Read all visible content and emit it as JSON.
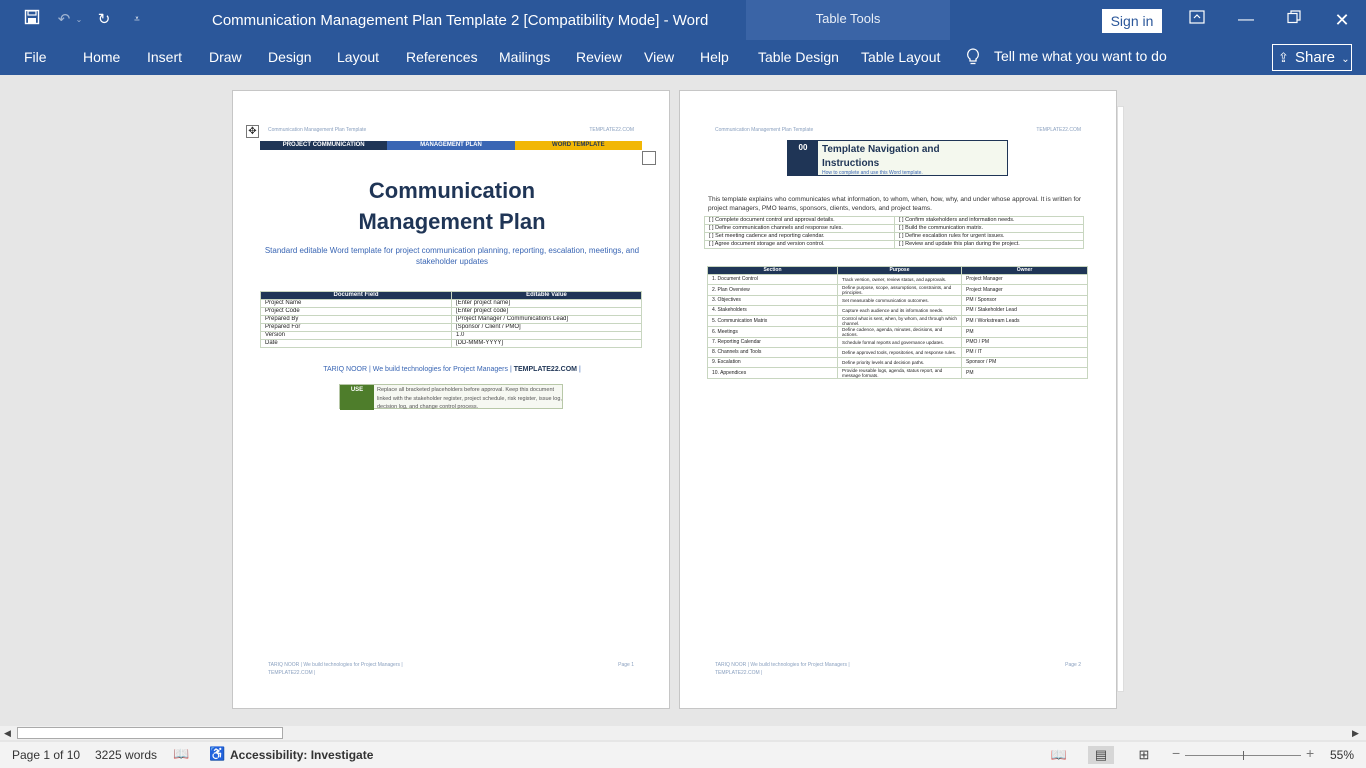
{
  "window": {
    "title": "Communication Management Plan Template 2 [Compatibility Mode]  -  Word",
    "context_label": "Table Tools",
    "sign_in": "Sign in"
  },
  "ribbon": {
    "tabs": [
      "File",
      "Home",
      "Insert",
      "Draw",
      "Design",
      "Layout",
      "References",
      "Mailings",
      "Review",
      "View",
      "Help",
      "Table Design",
      "Table Layout"
    ],
    "tell_me": "Tell me what you want to do",
    "share": "Share"
  },
  "page1": {
    "header_left": "Communication Management Plan Template",
    "header_right": "TEMPLATE22.COM",
    "band": [
      "PROJECT COMMUNICATION",
      "MANAGEMENT PLAN",
      "WORD TEMPLATE"
    ],
    "title_line1": "Communication",
    "title_line2": "Management Plan",
    "subtitle": "Standard editable Word template for project communication planning, reporting, escalation, meetings, and stakeholder updates",
    "table_headers": [
      "Document Field",
      "Editable Value"
    ],
    "table_rows": [
      [
        "Project Name",
        "[Enter project name]"
      ],
      [
        "Project Code",
        "[Enter project code]"
      ],
      [
        "Prepared By",
        "[Project Manager / Communications Lead]"
      ],
      [
        "Prepared For",
        "[Sponsor / Client / PMO]"
      ],
      [
        "Version",
        "1.0"
      ],
      [
        "Date",
        "[DD-MMM-YYYY]"
      ]
    ],
    "brand_text": "TARIQ NOOR | We build technologies for Project Managers |",
    "brand_bold": "TEMPLATE22.COM",
    "brand_end": "|",
    "use_tag": "USE",
    "use_text": "Replace all bracketed placeholders before approval. Keep this document linked with the stakeholder register, project schedule, risk register, issue log, decision log, and change control process.",
    "footer_left": "TARIQ NOOR | We build technologies for Project Managers | TEMPLATE22.COM |",
    "footer_right": "Page 1"
  },
  "page2": {
    "header_left": "Communication Management Plan Template",
    "header_right": "TEMPLATE22.COM",
    "nav_number": "00",
    "nav_title": "Template Navigation and Instructions",
    "nav_sub": "How to complete and use this Word template.",
    "intro": "This template explains who communicates what information, to whom, when, how, why, and under whose approval. It is written for project managers, PMO teams, sponsors, clients, vendors, and project teams.",
    "checklist": [
      [
        "[ ] Complete document control and approval details.",
        "[ ] Confirm stakeholders and information needs."
      ],
      [
        "[ ] Define communication channels and response rules.",
        "[ ] Build the communication matrix."
      ],
      [
        "[ ] Set meeting cadence and reporting calendar.",
        "[ ] Define escalation rules for urgent issues."
      ],
      [
        "[ ] Agree document storage and version control.",
        "[ ] Review and update this plan during the project."
      ]
    ],
    "sections_headers": [
      "Section",
      "Purpose",
      "Owner"
    ],
    "sections": [
      [
        "1. Document Control",
        "Track version, owner, review status, and approvals.",
        "Project Manager"
      ],
      [
        "2. Plan Overview",
        "Define purpose, scope, assumptions, constraints, and principles.",
        "Project Manager"
      ],
      [
        "3. Objectives",
        "Set measurable communication outcomes.",
        "PM / Sponsor"
      ],
      [
        "4. Stakeholders",
        "Capture each audience and its information needs.",
        "PM / Stakeholder Lead"
      ],
      [
        "5. Communication Matrix",
        "Control what is sent, when, by whom, and through which channel.",
        "PM / Workstream Leads"
      ],
      [
        "6. Meetings",
        "Define cadence, agenda, minutes, decisions, and actions.",
        "PM"
      ],
      [
        "7. Reporting Calendar",
        "Schedule formal reports and governance updates.",
        "PMO / PM"
      ],
      [
        "8. Channels and Tools",
        "Define approved tools, repositories, and response rules.",
        "PM / IT"
      ],
      [
        "9. Escalation",
        "Define priority levels and decision paths.",
        "Sponsor / PM"
      ],
      [
        "10. Appendices",
        "Provide reusable logs, agenda, status report, and message formats.",
        "PM"
      ]
    ],
    "footer_left": "TARIQ NOOR | We build technologies for Project Managers | TEMPLATE22.COM |",
    "footer_right": "Page 2"
  },
  "status": {
    "page": "Page 1 of 10",
    "words": "3225 words",
    "accessibility": "Accessibility: Investigate",
    "zoom": "55%"
  },
  "colors": {
    "brand_blue": "#2b579a",
    "navy": "#1f3556",
    "band_mid": "#3a66b4",
    "band_yellow": "#f2b705",
    "use_green": "#4e7d2b"
  }
}
